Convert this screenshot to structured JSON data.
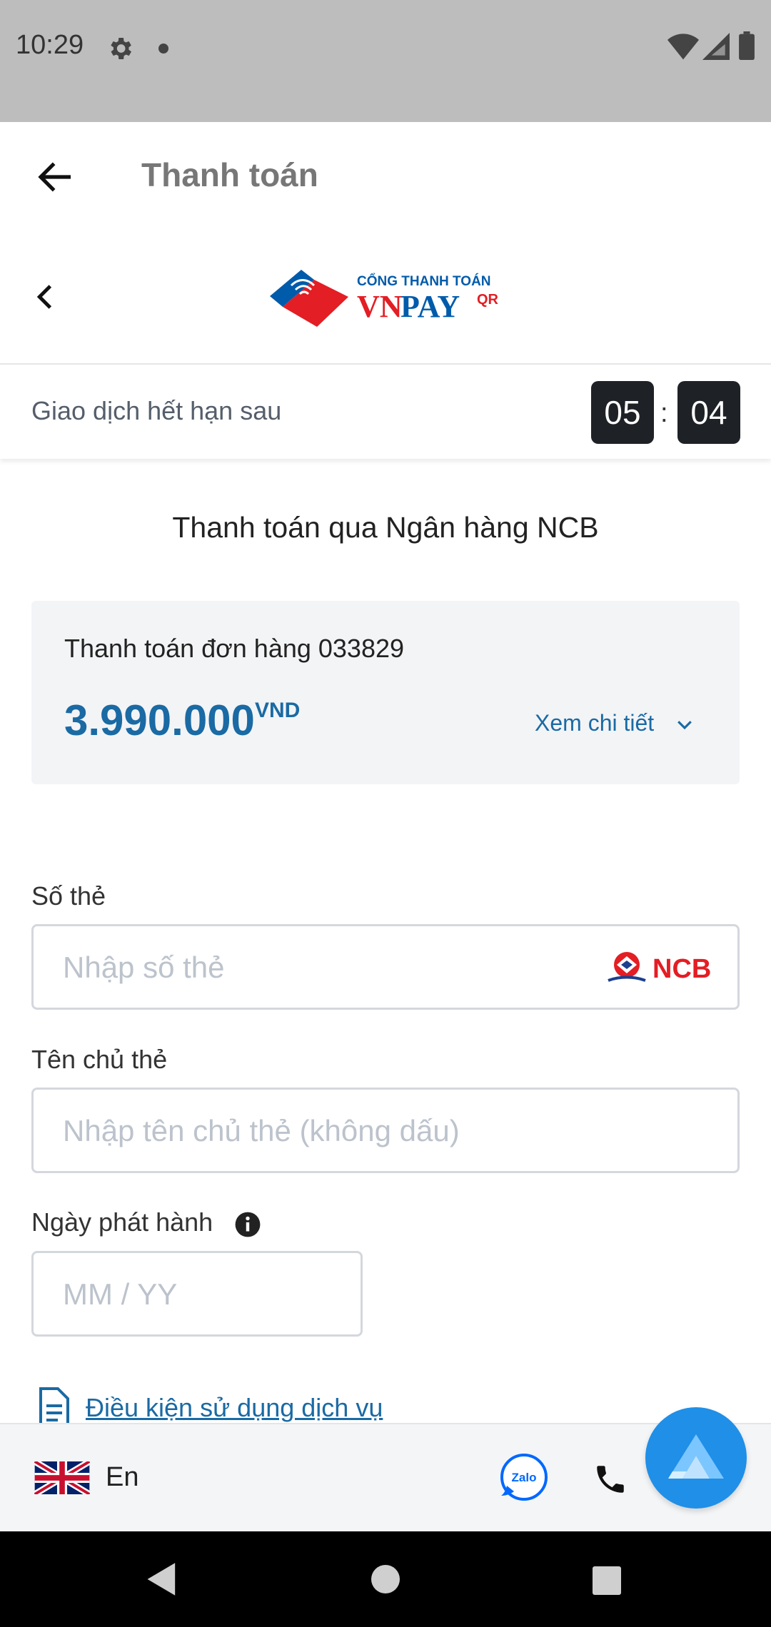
{
  "status_bar": {
    "time": "10:29"
  },
  "app_bar": {
    "title": "Thanh toán"
  },
  "logo": {
    "line1": "CỔNG THANH TOÁN",
    "brand_vn": "VN",
    "brand_pay": "PAY",
    "brand_qr": "QR"
  },
  "timer": {
    "label": "Giao dịch hết hạn sau",
    "minutes": "05",
    "separator": ":",
    "seconds": "04"
  },
  "payment": {
    "heading": "Thanh toán qua Ngân hàng NCB",
    "order_title": "Thanh toán đơn hàng 033829",
    "amount": "3.990.000",
    "currency": "VND",
    "detail_link": "Xem chi tiết"
  },
  "form": {
    "card_number": {
      "label": "Số thẻ",
      "placeholder": "Nhập số thẻ",
      "bank_logo": "NCB"
    },
    "holder_name": {
      "label": "Tên chủ thẻ",
      "placeholder": "Nhập tên chủ thẻ (không dấu)"
    },
    "issue_date": {
      "label": "Ngày phát hành",
      "placeholder": "MM / YY"
    }
  },
  "terms": {
    "link": "Điều kiện sử dụng dịch vụ"
  },
  "bottom_bar": {
    "language": "En",
    "zalo": "Zalo"
  },
  "colors": {
    "accent": "#1a6aa4",
    "fab": "#1f8fe8",
    "timer_bg": "#1e2125",
    "vnpay_red": "#e31e24",
    "vnpay_blue": "#005baa"
  }
}
